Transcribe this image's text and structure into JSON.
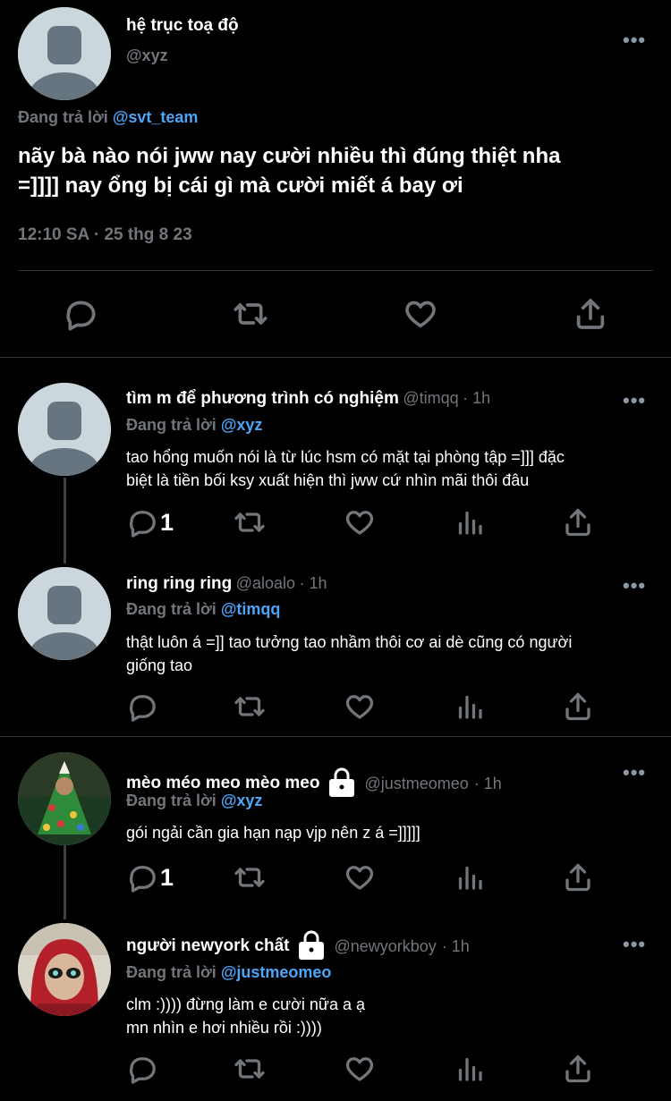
{
  "main_tweet": {
    "name": "hệ trục toạ độ",
    "handle": "@xyz",
    "replying_prefix": "Đang trả lời",
    "replying_to": "@svt_team",
    "text_line1": "nãy bà nào nói jww nay cười nhiều thì đúng thiệt nha",
    "text_line2": "=]]]] nay ổng bị cái gì mà cười miết á bay ơi",
    "timestamp": "12:10 SA · 25 thg 8 23"
  },
  "replies": [
    {
      "name": "tìm m để phương trình có nghiệm",
      "handle": "@timqq",
      "time": "· 1h",
      "replying_prefix": "Đang trả lời",
      "replying_to": "@xyz",
      "text_line1": "tao hổng muốn nói là từ lúc hsm có mặt tại phòng tập =]]] đặc",
      "text_line2": "biệt là tiền bối ksy xuất hiện thì jww cứ nhìn mãi thôi đâu",
      "reply_count": "1"
    },
    {
      "name": "ring ring ring",
      "handle": "@aloalo",
      "time": "· 1h",
      "replying_prefix": "Đang trả lời",
      "replying_to": "@timqq",
      "text_line1": "thật luôn á =]] tao tưởng tao nhầm thôi cơ ai dè cũng có người",
      "text_line2": "giống tao",
      "reply_count": ""
    },
    {
      "name": "mèo méo meo mèo meo",
      "handle": "@justmeomeo",
      "time": "· 1h",
      "replying_prefix": "Đang trả lời",
      "replying_to": "@xyz",
      "text_line1": "gói ngải cần gia hạn nạp vjp nên z á =]]]]]",
      "text_line2": "",
      "reply_count": "1"
    },
    {
      "name": "người newyork chất",
      "handle": "@newyorkboy",
      "time": "· 1h",
      "replying_prefix": "Đang trả lời",
      "replying_to": "@justmeomeo",
      "text_line1": "clm :)))) đừng làm e cười nữa a ạ",
      "text_line2": "mn nhìn e hơi nhiều rồi :))))",
      "reply_count": ""
    }
  ],
  "more_label": "•••",
  "icons": [
    "reply-icon",
    "retweet-icon",
    "like-icon",
    "share-icon",
    "views-icon",
    "lock-icon",
    "more-icon"
  ],
  "colors": {
    "background": "#000000",
    "mention": "#4ea4f7",
    "muted": "#71767b",
    "divider": "#2f3336"
  }
}
